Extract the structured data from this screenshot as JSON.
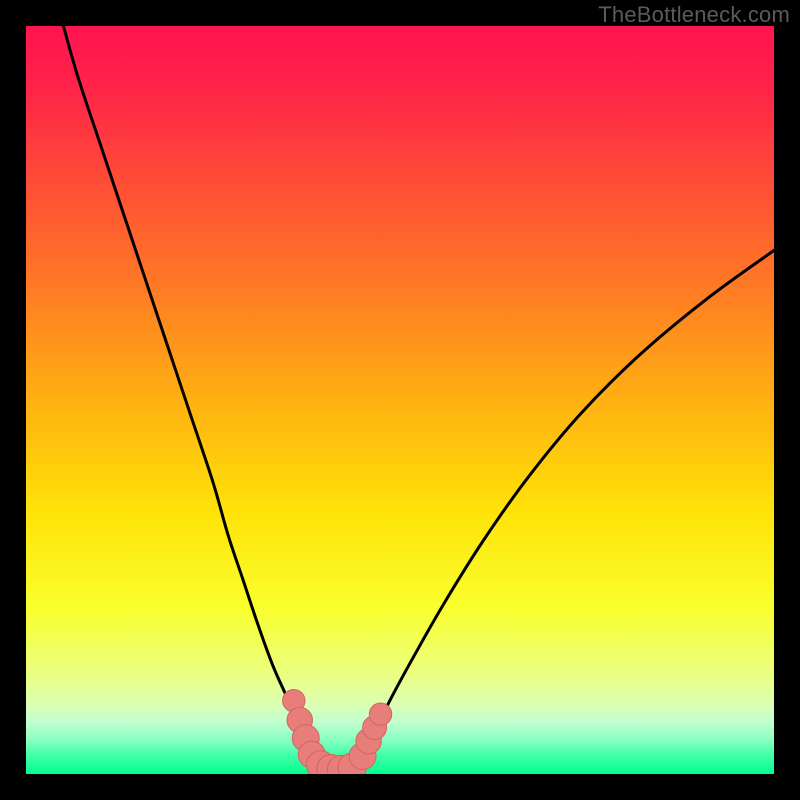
{
  "watermark": "TheBottleneck.com",
  "colors": {
    "frame": "#000000",
    "curve": "#000000",
    "marker_fill": "#e77e7a",
    "marker_stroke": "#d16561",
    "gradient_stops": [
      {
        "offset": 0.0,
        "color": "#ff1450"
      },
      {
        "offset": 0.08,
        "color": "#ff2349"
      },
      {
        "offset": 0.2,
        "color": "#ff4a38"
      },
      {
        "offset": 0.35,
        "color": "#ff7a24"
      },
      {
        "offset": 0.5,
        "color": "#ffb012"
      },
      {
        "offset": 0.65,
        "color": "#ffe308"
      },
      {
        "offset": 0.78,
        "color": "#f9ff2f"
      },
      {
        "offset": 0.86,
        "color": "#ecff7a"
      },
      {
        "offset": 0.905,
        "color": "#ddffb0"
      },
      {
        "offset": 0.93,
        "color": "#c2ffcf"
      },
      {
        "offset": 0.955,
        "color": "#86ffc0"
      },
      {
        "offset": 0.975,
        "color": "#40ffa8"
      },
      {
        "offset": 1.0,
        "color": "#00ff91"
      }
    ]
  },
  "chart_data": {
    "type": "line",
    "title": "",
    "xlabel": "",
    "ylabel": "",
    "xlim": [
      0,
      100
    ],
    "ylim": [
      0,
      100
    ],
    "series": [
      {
        "name": "left-branch",
        "x": [
          5,
          7,
          10,
          13,
          16,
          19,
          22,
          25,
          27,
          29,
          31,
          33,
          35,
          36.5,
          37.5,
          38.2
        ],
        "y": [
          100,
          93,
          84,
          75,
          66,
          57,
          48,
          39,
          32,
          26,
          20,
          14.5,
          10,
          6.5,
          3.8,
          1.5
        ]
      },
      {
        "name": "right-branch",
        "x": [
          44.8,
          45.5,
          47,
          49,
          52,
          56,
          61,
          67,
          74,
          82,
          91,
          100
        ],
        "y": [
          1.5,
          3.5,
          6.5,
          10.5,
          16,
          23,
          31,
          39.5,
          48,
          56,
          63.5,
          70
        ]
      },
      {
        "name": "valley-floor",
        "x": [
          38.2,
          39.5,
          41.0,
          42.5,
          44.0,
          44.8
        ],
        "y": [
          1.5,
          0.6,
          0.3,
          0.3,
          0.6,
          1.5
        ]
      }
    ],
    "markers": [
      {
        "name": "left-cluster-1",
        "x": 35.8,
        "y": 9.8,
        "r": 1.5
      },
      {
        "name": "left-cluster-2",
        "x": 36.6,
        "y": 7.2,
        "r": 1.7
      },
      {
        "name": "left-cluster-3",
        "x": 37.4,
        "y": 4.8,
        "r": 1.8
      },
      {
        "name": "left-cluster-4",
        "x": 38.2,
        "y": 2.6,
        "r": 1.8
      },
      {
        "name": "floor-1",
        "x": 39.4,
        "y": 1.2,
        "r": 1.9
      },
      {
        "name": "floor-2",
        "x": 40.8,
        "y": 0.7,
        "r": 1.9
      },
      {
        "name": "floor-3",
        "x": 42.2,
        "y": 0.6,
        "r": 1.9
      },
      {
        "name": "floor-4",
        "x": 43.6,
        "y": 0.9,
        "r": 1.9
      },
      {
        "name": "right-cluster-1",
        "x": 45.0,
        "y": 2.4,
        "r": 1.8
      },
      {
        "name": "right-cluster-2",
        "x": 45.8,
        "y": 4.4,
        "r": 1.7
      },
      {
        "name": "right-cluster-3",
        "x": 46.6,
        "y": 6.2,
        "r": 1.6
      },
      {
        "name": "right-cluster-4",
        "x": 47.4,
        "y": 8.0,
        "r": 1.5
      }
    ]
  }
}
